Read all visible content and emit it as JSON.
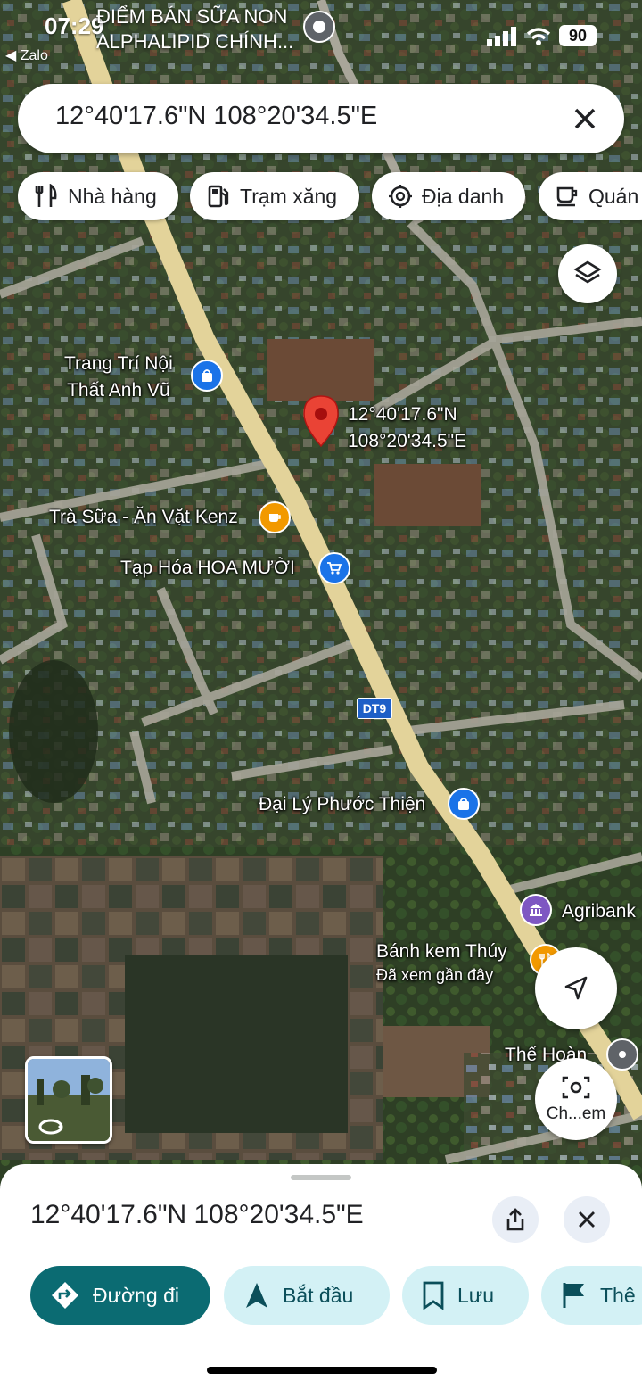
{
  "status": {
    "time": "07:29",
    "back_app": "◀ Zalo",
    "top_place_line1": "ĐIỂM BÁN SỮA NON",
    "top_place_line2": "ALPHALIPID CHÍNH...",
    "battery": "90"
  },
  "search": {
    "query": "12°40'17.6\"N 108°20'34.5\"E"
  },
  "chips": [
    {
      "label": "Nhà hàng",
      "icon": "restaurant-icon"
    },
    {
      "label": "Trạm xăng",
      "icon": "gas-station-icon"
    },
    {
      "label": "Địa danh",
      "icon": "landmark-icon"
    },
    {
      "label": "Quán",
      "icon": "cafe-icon"
    }
  ],
  "map": {
    "pin_label_line1": "12°40'17.6\"N",
    "pin_label_line2": "108°20'34.5\"E",
    "road_shield": "DT9",
    "places": [
      {
        "name_line1": "Trang Trí Nội",
        "name_line2": "Thất Anh Vũ",
        "icon": "shopping-bag-icon",
        "color": "#1a73e8"
      },
      {
        "name": "Trà Sữa - Ăn Vặt Kenz",
        "icon": "coffee-cup-icon",
        "color": "#f29900"
      },
      {
        "name": "Tạp Hóa HOA MƯỜI",
        "icon": "shopping-cart-icon",
        "color": "#1a73e8"
      },
      {
        "name": "Đại Lý Phước Thiện",
        "icon": "shopping-bag-icon",
        "color": "#1a73e8"
      },
      {
        "name": "Agribank",
        "icon": "bank-icon",
        "color": "#7e57c2"
      },
      {
        "name": "Bánh kem Thúy",
        "subtitle": "Đã xem gần đây",
        "icon": "restaurant-icon",
        "color": "#f29900"
      },
      {
        "name": "Thế Hoàn",
        "icon": "place-icon",
        "color": "#5f6368"
      }
    ],
    "lens_label": "Ch...em"
  },
  "sheet": {
    "title": "12°40'17.6\"N 108°20'34.5\"E",
    "actions": [
      {
        "label": "Đường đi",
        "icon": "directions-icon"
      },
      {
        "label": "Bắt đầu",
        "icon": "navigation-arrow-icon"
      },
      {
        "label": "Lưu",
        "icon": "bookmark-icon"
      },
      {
        "label": "Thê",
        "icon": "flag-icon"
      }
    ]
  },
  "colors": {
    "primary_action": "#0b6b72",
    "secondary_action": "#d3f1f5",
    "pin_red": "#ea4335",
    "road": "#e3d39a"
  }
}
